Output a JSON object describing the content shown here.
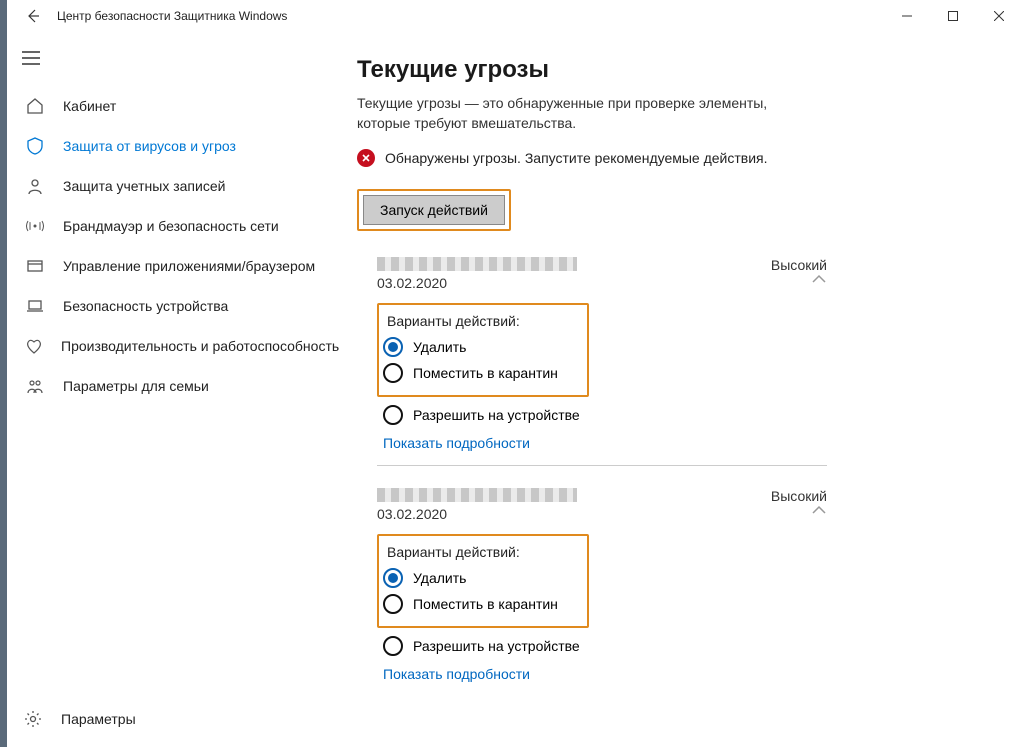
{
  "window": {
    "title": "Центр безопасности Защитника Windows"
  },
  "sidebar": {
    "items": [
      {
        "label": "Кабинет"
      },
      {
        "label": "Защита от вирусов и угроз"
      },
      {
        "label": "Защита учетных записей"
      },
      {
        "label": "Брандмауэр и безопасность сети"
      },
      {
        "label": "Управление приложениями/браузером"
      },
      {
        "label": "Безопасность устройства"
      },
      {
        "label": "Производительность и работоспособность"
      },
      {
        "label": "Параметры для семьи"
      }
    ],
    "settings_label": "Параметры"
  },
  "page": {
    "title": "Текущие угрозы",
    "description": "Текущие угрозы — это обнаруженные при проверке элементы, которые требуют вмешательства.",
    "alert_text": "Обнаружены угрозы. Запустите рекомендуемые действия.",
    "action_button": "Запуск действий",
    "options_label": "Варианты действий:",
    "option_delete": "Удалить",
    "option_quarantine": "Поместить в карантин",
    "option_allow": "Разрешить на устройстве",
    "show_details": "Показать подробности"
  },
  "threats": [
    {
      "date": "03.02.2020",
      "level": "Высокий"
    },
    {
      "date": "03.02.2020",
      "level": "Высокий"
    }
  ]
}
